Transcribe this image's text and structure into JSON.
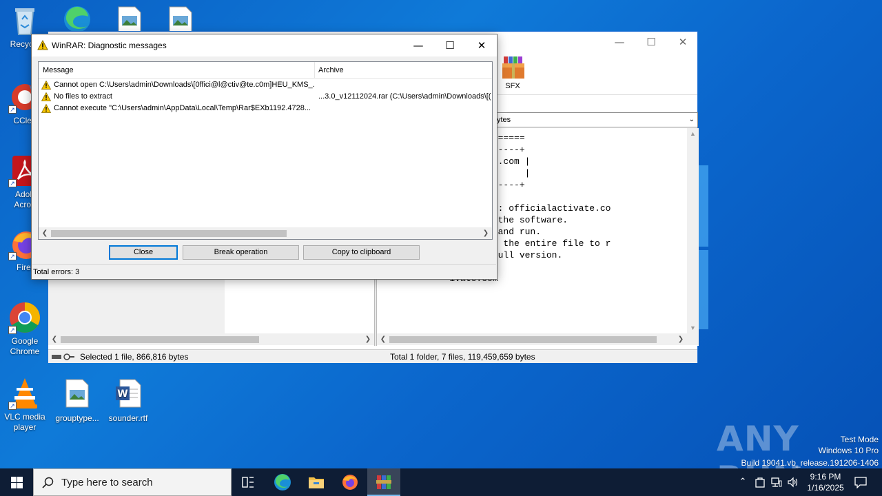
{
  "desktop": {
    "icons": [
      {
        "label": "Recycle"
      },
      {
        "label": "CClea"
      },
      {
        "label": "Adob Acrob"
      },
      {
        "label": "Firef"
      },
      {
        "label": "Google Chrome"
      },
      {
        "label": "VLC media player"
      },
      {
        "label": "grouptype..."
      },
      {
        "label": "sounder.rtf"
      }
    ]
  },
  "main_window": {
    "toolbar": {
      "sfx_label": "SFX"
    },
    "address_text": "ytes",
    "text_lines": [
      "        vate.com ==========",
      "        ------------------+",
      "        ficialactivate.com |",
      "        activate.com       |",
      "        ------------------+",
      "",
      "         With Password: officialactivate.co",
      "        t file to use the software.",
      "        ly or extract and run.",
      "         to decompress the entire file to r",
      "         to view the full version.",
      "",
      "             ivate.com"
    ],
    "status_left": "Selected 1 file, 866,816 bytes",
    "status_right": "Total 1 folder, 7 files, 119,459,659 bytes"
  },
  "dialog": {
    "title": "WinRAR: Diagnostic messages",
    "columns": {
      "message": "Message",
      "archive": "Archive"
    },
    "rows": [
      {
        "message": "Cannot open C:\\Users\\admin\\Downloads\\[0ffici@l@ctiv@te.c0m]HEU_KMS_...",
        "archive": ""
      },
      {
        "message": "No files to extract",
        "archive": "...3.0_v12112024.rar (C:\\Users\\admin\\Downloads\\[("
      },
      {
        "message": "Cannot execute \"C:\\Users\\admin\\AppData\\Local\\Temp\\Rar$EXb1192.4728...",
        "archive": ""
      }
    ],
    "buttons": {
      "close": "Close",
      "break": "Break operation",
      "copy": "Copy to clipboard"
    },
    "total_errors": "Total errors: 3"
  },
  "watermark": {
    "brand": "ANY RUN",
    "test_mode": "Test Mode",
    "edition": "Windows 10 Pro",
    "build": "Build 19041.vb_release.191206-1406"
  },
  "taskbar": {
    "search_placeholder": "Type here to search",
    "time": "9:16 PM",
    "date": "1/16/2025"
  }
}
